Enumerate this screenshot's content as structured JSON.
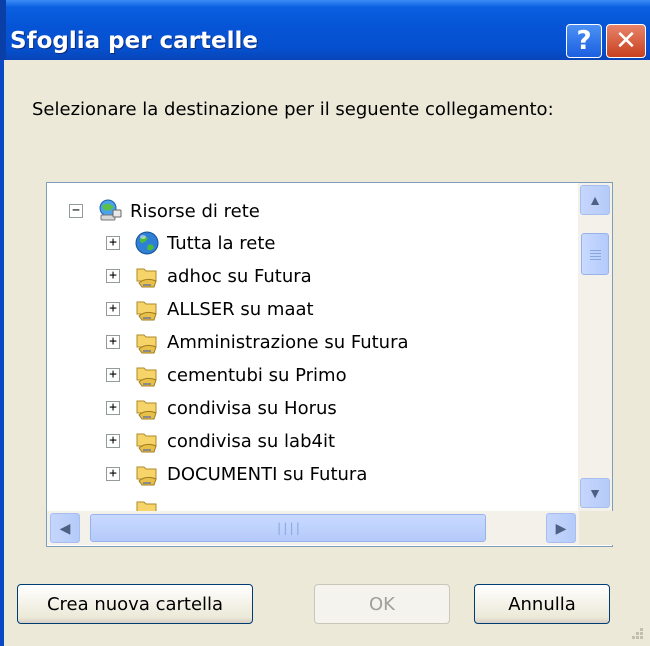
{
  "window": {
    "title": "Sfoglia per cartelle",
    "help_glyph": "?",
    "close_glyph": "✕"
  },
  "instruction": "Selezionare la destinazione per il seguente collegamento:",
  "tree": {
    "root": {
      "label": "Risorse di rete",
      "expander": "−",
      "icon": "network-places-icon"
    },
    "items": [
      {
        "label": "Tutta la rete",
        "expander": "+",
        "icon": "globe-icon"
      },
      {
        "label": "adhoc su Futura",
        "expander": "+",
        "icon": "network-share-icon"
      },
      {
        "label": "ALLSER su maat",
        "expander": "+",
        "icon": "network-share-icon"
      },
      {
        "label": "Amministrazione su Futura",
        "expander": "+",
        "icon": "network-share-icon"
      },
      {
        "label": "cementubi su Primo",
        "expander": "+",
        "icon": "network-share-icon"
      },
      {
        "label": "condivisa su Horus",
        "expander": "+",
        "icon": "network-share-icon"
      },
      {
        "label": "condivisa su lab4it",
        "expander": "+",
        "icon": "network-share-icon"
      },
      {
        "label": "DOCUMENTI su Futura",
        "expander": "+",
        "icon": "network-share-icon"
      }
    ]
  },
  "scrollbar": {
    "up": "▲",
    "down": "▼",
    "left": "◀",
    "right": "▶",
    "h_grip": "||||"
  },
  "buttons": {
    "new_folder": "Crea nuova cartella",
    "ok": "OK",
    "cancel": "Annulla"
  },
  "colors": {
    "titlebar": "#0654d6",
    "dialog_bg": "#ece9d8",
    "tree_border": "#7f9db9"
  }
}
